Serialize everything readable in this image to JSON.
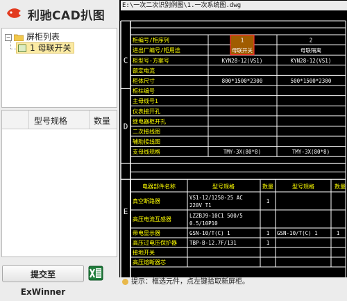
{
  "app": {
    "title": "利驰CAD扒图",
    "logo_icon": "fish-logo-icon"
  },
  "tree": {
    "root_label": "屏柜列表",
    "child_label": "1 母联开关",
    "toggle_symbol": "−"
  },
  "spec_table": {
    "columns": [
      "型号规格",
      "数量"
    ]
  },
  "submit": {
    "label": "提交至 ExWinner"
  },
  "excel": {
    "icon": "excel-icon"
  },
  "drawing": {
    "file_path": "E:\\一次二次识别例图\\1.一次系统图.dwg",
    "colors": {
      "line": "#ffffff",
      "label": "#ffff00",
      "value": "#ffffff",
      "section": "#ffffff",
      "highlight_fill": "#a05c00",
      "highlight_border": "#ff3030"
    },
    "section_letters": [
      "C",
      "D",
      "E"
    ],
    "upper_rows": [
      {
        "label": "柜编号/柜序列",
        "v1": "1",
        "v2": "2"
      },
      {
        "label": "进出厂编号/柜用途",
        "v1": "母联开关",
        "v2": "母联隔离"
      },
      {
        "label": "柜型号-方案号",
        "v1": "KYN28-12(VS1)",
        "v2": "KYN28-12(VS1)"
      },
      {
        "label": "额定电流",
        "v1": "",
        "v2": ""
      },
      {
        "label": "柜体尺寸",
        "v1": "800*1500*2300",
        "v2": "500*1500*2300"
      },
      {
        "label": "柜柱编号",
        "v1": "",
        "v2": ""
      },
      {
        "label": "主母线号1",
        "v1": "",
        "v2": ""
      },
      {
        "label": "仪表接开孔",
        "v1": "",
        "v2": ""
      },
      {
        "label": "继电器柜开孔",
        "v1": "",
        "v2": ""
      },
      {
        "label": "二次接线图",
        "v1": "",
        "v2": ""
      },
      {
        "label": "辅助接线图",
        "v1": "",
        "v2": ""
      },
      {
        "label": "支母线规格",
        "v1": "TMY-3X(80*8)",
        "v2": "TMY-3X(80*8)"
      }
    ],
    "lower_header": {
      "c1": "电器部件名称",
      "c2": "型号规格",
      "c3": "数量",
      "c4": "型号规格",
      "c5": "数量"
    },
    "lower_rows": [
      {
        "name": "真空断路器",
        "spec": [
          "VS1-12/1250-25 AC",
          "220V T1"
        ],
        "qty": "1",
        "spec2": "",
        "qty2": ""
      },
      {
        "name": "高压电流互感器",
        "spec": [
          "LZZBJ9-10C1 500/5",
          "0.5/10P10"
        ],
        "qty": "",
        "spec2": "",
        "qty2": ""
      },
      {
        "name": "带电显示器",
        "spec": [
          "GSN-10/T(C) 1"
        ],
        "qty": "1",
        "spec2": "GSN-10/T(C) 1",
        "qty2": "1"
      },
      {
        "name": "高压过电压保护器",
        "spec": [
          "TBP-B-12.7F/131"
        ],
        "qty": "1",
        "spec2": "",
        "qty2": ""
      },
      {
        "name": "接地开关",
        "spec": [
          ""
        ],
        "qty": "",
        "spec2": "",
        "qty2": ""
      },
      {
        "name": "高压熔断器芯",
        "spec": [
          ""
        ],
        "qty": "",
        "spec2": "",
        "qty2": ""
      }
    ]
  },
  "hint": {
    "icon": "info-icon",
    "text": "提示：框选元件，点左键拾取新屏柜。"
  }
}
